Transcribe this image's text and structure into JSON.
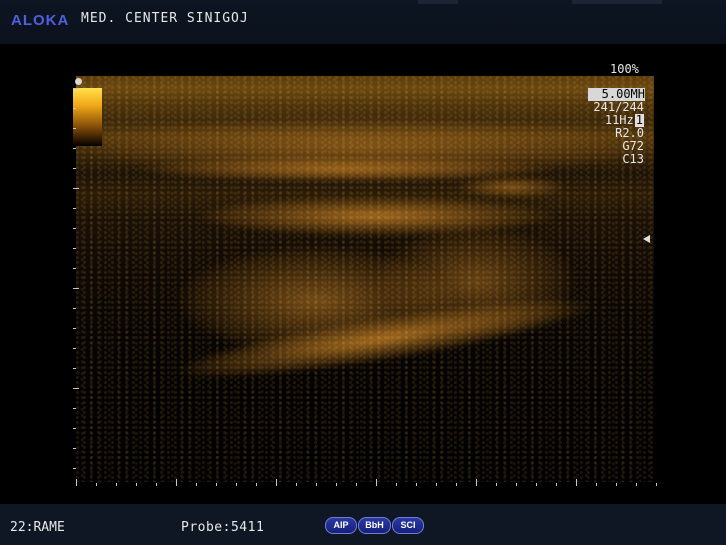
{
  "header": {
    "brand": "ALOKA",
    "center_name": "MED. CENTER SINIGOJ"
  },
  "parameters": {
    "zoom": "100%",
    "frequency": "5.00MH",
    "depth_gain": "241/244",
    "frame_rate": "11Hz",
    "frame_index": "1",
    "range": "R2.0",
    "gain": "G72",
    "contrast": "C13"
  },
  "footer": {
    "patient_label": "22:RAME",
    "probe_label": "Probe:5411",
    "buttons": [
      "AIP",
      "BbH",
      "SCI"
    ]
  },
  "colors": {
    "brand": "#4f5fe0",
    "image_tint": "#b8781f",
    "bar_background": "#0f1724",
    "button_fill": "#1e2b90"
  }
}
